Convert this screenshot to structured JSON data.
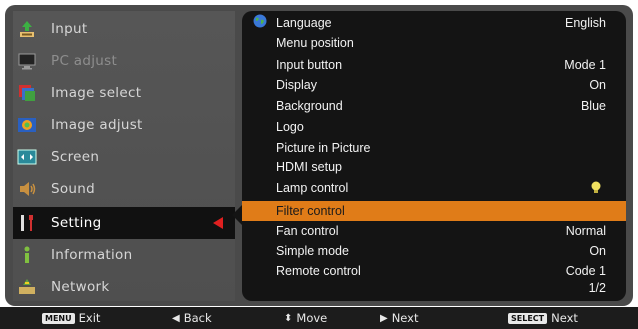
{
  "sidebar": {
    "items": [
      {
        "label": "Input",
        "icon": "input-icon"
      },
      {
        "label": "PC adjust",
        "icon": "monitor-icon"
      },
      {
        "label": "Image select",
        "icon": "image-select-icon"
      },
      {
        "label": "Image adjust",
        "icon": "image-adjust-icon"
      },
      {
        "label": "Screen",
        "icon": "screen-icon"
      },
      {
        "label": "Sound",
        "icon": "speaker-icon"
      },
      {
        "label": "Setting",
        "icon": "tools-icon"
      },
      {
        "label": "Information",
        "icon": "information-icon"
      },
      {
        "label": "Network",
        "icon": "network-icon"
      }
    ],
    "active": "Setting"
  },
  "menu": {
    "rows": [
      {
        "label": "Language",
        "value": "English"
      },
      {
        "label": "Menu position",
        "value": ""
      },
      {
        "label": "Input button",
        "value": "Mode 1"
      },
      {
        "label": "Display",
        "value": "On"
      },
      {
        "label": "Background",
        "value": "Blue"
      },
      {
        "label": "Logo",
        "value": ""
      },
      {
        "label": "Picture in Picture",
        "value": ""
      },
      {
        "label": "HDMI setup",
        "value": ""
      },
      {
        "label": "Lamp control",
        "value": ""
      },
      {
        "label": "Filter control",
        "value": ""
      },
      {
        "label": "Fan control",
        "value": "Normal"
      },
      {
        "label": "Simple mode",
        "value": "On"
      },
      {
        "label": "Remote control",
        "value": "Code 1"
      }
    ],
    "page": "1/2",
    "highlighted": "Filter control",
    "highlight_color": "#e07c18"
  },
  "bottom_bar": {
    "exit_key": "MENU",
    "exit": "Exit",
    "back": "Back",
    "move": "Move",
    "next": "Next",
    "select_key": "SELECT",
    "select_next": "Next"
  }
}
